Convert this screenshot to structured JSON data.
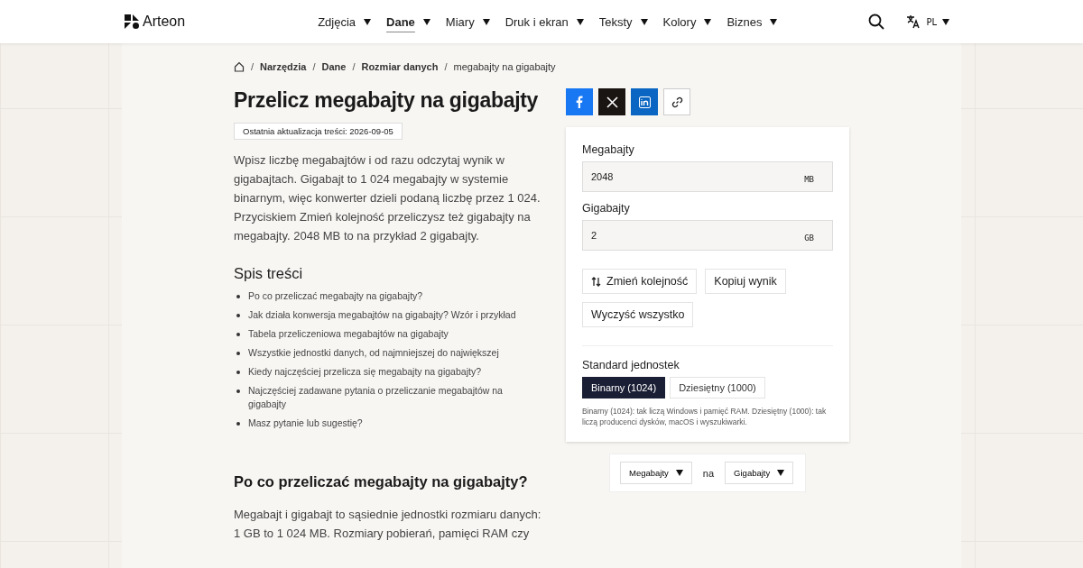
{
  "header": {
    "logo": "Arteon",
    "nav": [
      {
        "label": "Zdjęcia",
        "selected": false
      },
      {
        "label": "Dane",
        "selected": true
      },
      {
        "label": "Miary",
        "selected": false
      },
      {
        "label": "Druk i ekran",
        "selected": false
      },
      {
        "label": "Teksty",
        "selected": false
      },
      {
        "label": "Kolory",
        "selected": false
      },
      {
        "label": "Biznes",
        "selected": false
      }
    ],
    "language": {
      "code": "PL",
      "expanded": false
    }
  },
  "breadcrumbs": {
    "separator": "/",
    "items": [
      "Narzędzia",
      "Dane",
      "Rozmiar danych",
      "megabajty na gigabajty"
    ]
  },
  "title": "Przelicz megabajty na gigabajty",
  "updated": "Ostatnia aktualizacja treści: 2026-09-05",
  "intro": "Wpisz liczbę megabajtów i od razu odczytaj wynik w gigabajtach. Gigabajt to 1 024 megabajty w systemie binarnym, więc konwerter dzieli podaną liczbę przez 1 024. Przyciskiem Zmień kolejność przeliczysz też gigabajty na megabajty. 2048 MB to na przykład 2 gigabajty.",
  "toc": {
    "title": "Spis treści",
    "items": [
      "Po co przeliczać megabajty na gigabajty?",
      "Jak działa konwersja megabajtów na gigabajty? Wzór i przykład",
      "Tabela przeliczeniowa megabajtów na gigabajty",
      "Wszystkie jednostki danych, od najmniejszej do największej",
      "Kiedy najczęściej przelicza się megabajty na gigabajty?",
      "Najczęściej zadawane pytania o przeliczanie megabajtów na gigabajty",
      "Masz pytanie lub sugestię?"
    ]
  },
  "section": {
    "title": "Po co przeliczać megabajty na gigabajty?",
    "text": "Megabajt i gigabajt to sąsiednie jednostki rozmiaru danych: 1 GB to 1 024 MB. Rozmiary pobierań, pamięci RAM czy"
  },
  "share": [
    {
      "kind": "facebook"
    },
    {
      "kind": "x"
    },
    {
      "kind": "linkedin"
    },
    {
      "kind": "link"
    }
  ],
  "converter": {
    "fields": [
      {
        "label": "Megabajty",
        "value": "2048",
        "unit": "MB"
      },
      {
        "label": "Gigabajty",
        "value": "2",
        "unit": "GB"
      }
    ],
    "buttons": [
      {
        "label": "Zmień kolejność",
        "kind": "swap"
      },
      {
        "label": "Kopiuj wynik",
        "kind": "plain"
      },
      {
        "label": "Wyczyść wszystko",
        "kind": "plain"
      }
    ],
    "standard": {
      "label": "Standard jednostek",
      "options": [
        {
          "label": "Binarny (1024)",
          "selected": true
        },
        {
          "label": "Dziesiętny (1000)",
          "selected": false
        }
      ],
      "note": "Binarny (1024): tak liczą Windows i pamięć RAM. Dziesiętny (1000): tak liczą producenci dysków, macOS i wyszukiwarki."
    }
  },
  "unit_picker": {
    "from": "Megabajty",
    "joiner": "na",
    "to": "Gigabajty"
  }
}
